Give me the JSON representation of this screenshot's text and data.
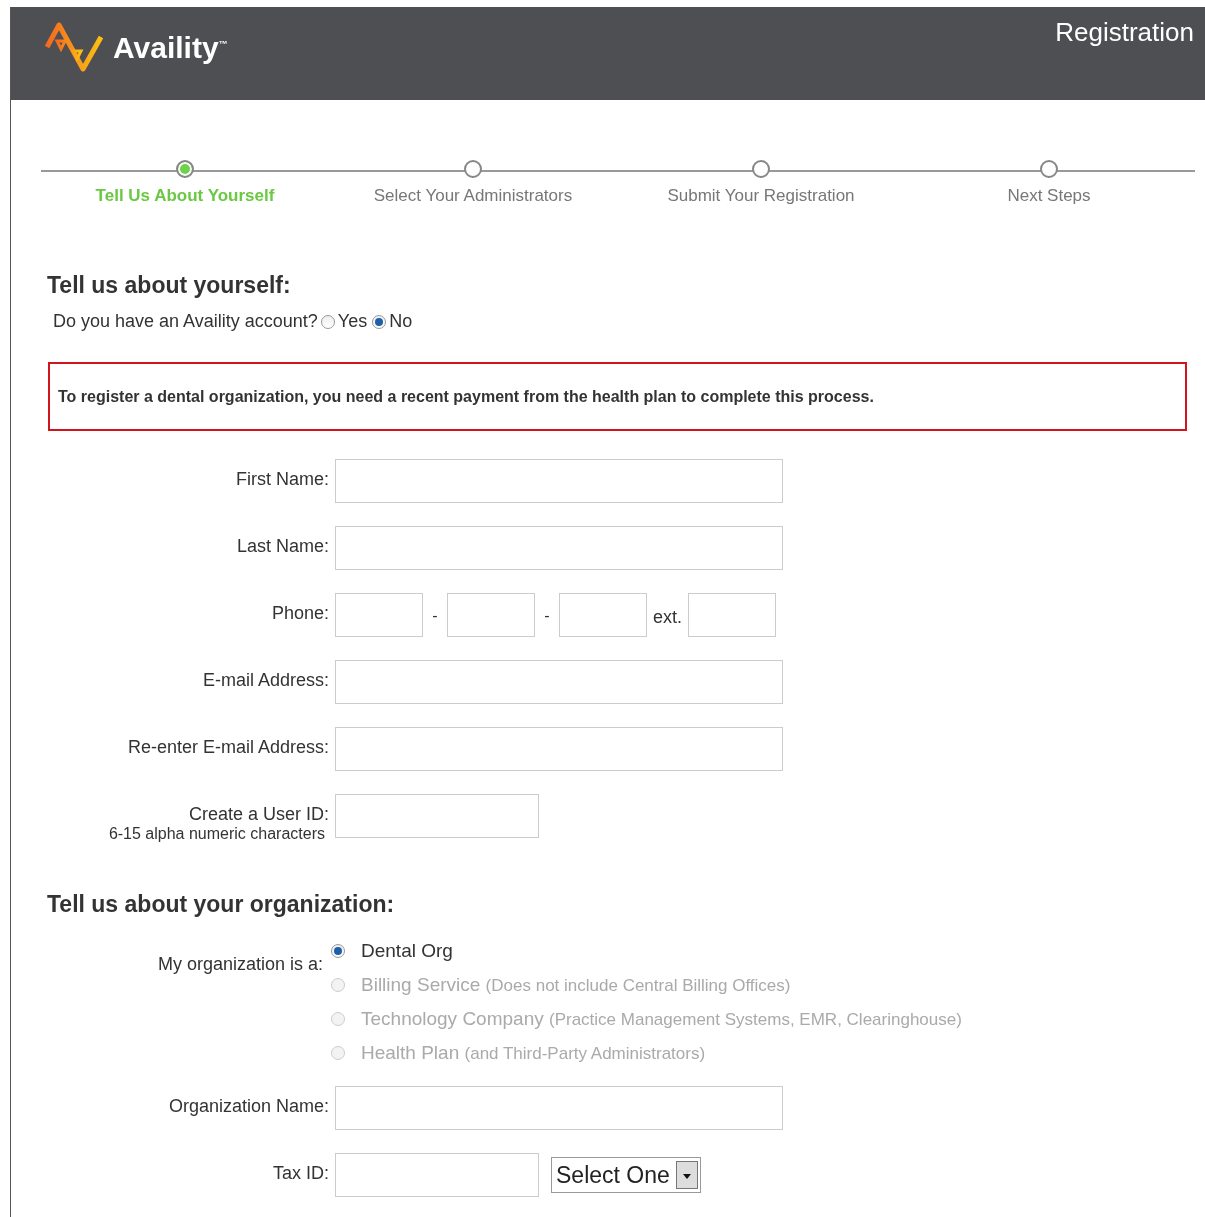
{
  "header": {
    "logo_text": "Availity",
    "logo_mark": "™",
    "title": "Registration"
  },
  "steps": [
    {
      "label": "Tell Us About Yourself",
      "selected": true
    },
    {
      "label": "Select Your Administrators",
      "selected": false
    },
    {
      "label": "Submit Your Registration",
      "selected": false
    },
    {
      "label": "Next Steps",
      "selected": false
    }
  ],
  "section_1": {
    "heading": "Tell us about yourself:",
    "question": "Do you have an Availity account?",
    "options": [
      {
        "label": "Yes",
        "selected": false
      },
      {
        "label": "No",
        "selected": true
      }
    ]
  },
  "notice": "To register a dental organization, you need a recent payment from the health plan to complete this process.",
  "fields": [
    {
      "kind": "text",
      "label": "First Name:"
    },
    {
      "kind": "text",
      "label": "Last Name:"
    },
    {
      "kind": "phone",
      "label": "Phone:",
      "separators": [
        "-",
        "-"
      ],
      "ext_label": "ext."
    },
    {
      "kind": "text",
      "label": "E-mail Address:"
    },
    {
      "kind": "text",
      "label": "Re-enter E-mail Address:"
    },
    {
      "kind": "short",
      "label": "Create a User ID:",
      "hint": "6-15 alpha numeric characters"
    }
  ],
  "section_2": {
    "heading": "Tell us about your organization:",
    "org_label": "My organization is a:",
    "org_types": [
      {
        "label": "Dental Org",
        "selected": true,
        "disabled": false
      },
      {
        "label": "Billing Service",
        "note": "(Does not include Central Billing Offices)",
        "selected": false,
        "disabled": true
      },
      {
        "label": "Technology Company",
        "note": "(Practice Management Systems, EMR, Clearinghouse)",
        "selected": false,
        "disabled": true
      },
      {
        "label": "Health Plan",
        "note": "(and Third-Party Administrators)",
        "selected": false,
        "disabled": true
      }
    ]
  },
  "org_fields": [
    {
      "kind": "text",
      "label": "Organization Name:"
    },
    {
      "kind": "tax",
      "label": "Tax ID:",
      "select": "Select One"
    }
  ]
}
